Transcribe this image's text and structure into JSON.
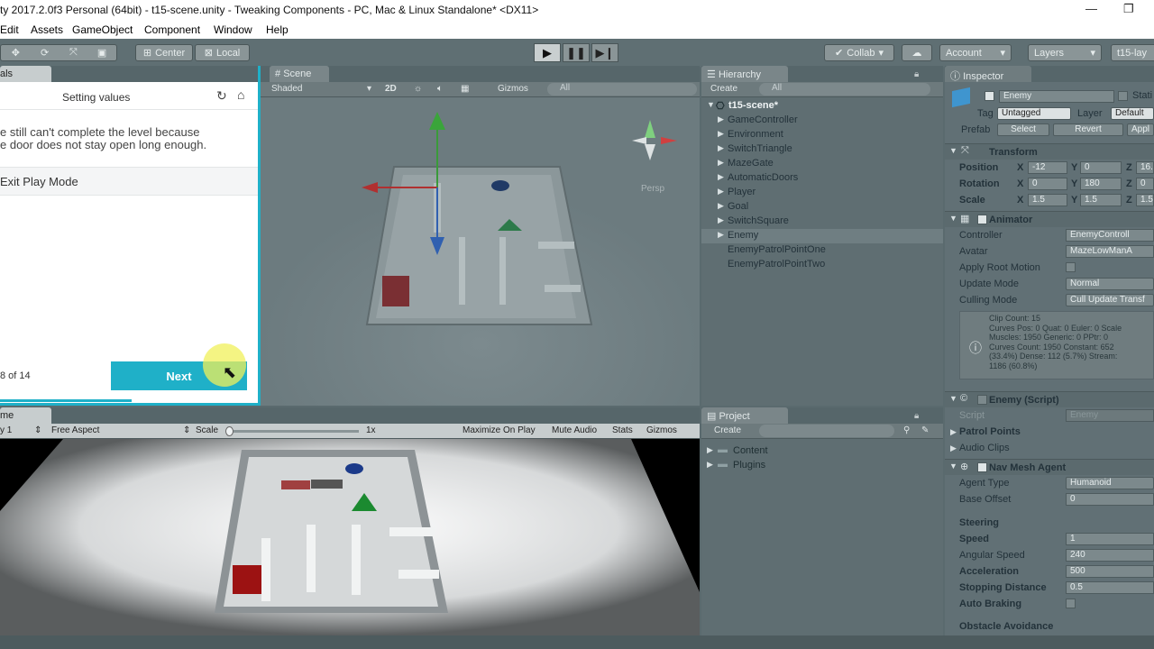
{
  "window": {
    "title": "ty 2017.2.0f3 Personal (64bit) - t15-scene.unity - Tweaking Components - PC, Mac & Linux Standalone* <DX11>"
  },
  "menu": [
    "Edit",
    "Assets",
    "GameObject",
    "Component",
    "Window",
    "Help"
  ],
  "toolbar": {
    "center": "Center",
    "local": "Local",
    "collab": "Collab",
    "account": "Account",
    "layers": "Layers",
    "layout": "t15-lay"
  },
  "tutorial": {
    "tab": "als",
    "title": "Setting values",
    "body_line1": "e still can't complete the level because",
    "body_line2": "e door does not stay open long enough.",
    "step": "Exit Play Mode",
    "progress": "8 of 14",
    "next": "Next"
  },
  "scene": {
    "tab": "Scene",
    "shading": "Shaded",
    "mode2d": "2D",
    "gizmos": "Gizmos",
    "search": "All",
    "persp": "Persp"
  },
  "hierarchy": {
    "tab": "Hierarchy",
    "create": "Create",
    "search": "All",
    "root": "t15-scene*",
    "items": [
      {
        "label": "GameController",
        "prefab": true,
        "arrow": true
      },
      {
        "label": "Environment",
        "prefab": false,
        "arrow": true
      },
      {
        "label": "SwitchTriangle",
        "prefab": true,
        "arrow": true
      },
      {
        "label": "MazeGate",
        "prefab": true,
        "arrow": true
      },
      {
        "label": "AutomaticDoors",
        "prefab": true,
        "arrow": true
      },
      {
        "label": "Player",
        "prefab": true,
        "arrow": true
      },
      {
        "label": "Goal",
        "prefab": true,
        "arrow": true
      },
      {
        "label": "SwitchSquare",
        "prefab": true,
        "arrow": true
      },
      {
        "label": "Enemy",
        "prefab": true,
        "arrow": true,
        "selected": true
      },
      {
        "label": "EnemyPatrolPointOne",
        "prefab": false,
        "arrow": false
      },
      {
        "label": "EnemyPatrolPointTwo",
        "prefab": false,
        "arrow": false
      }
    ]
  },
  "game": {
    "tab": "me",
    "display": "y 1",
    "aspect": "Free Aspect",
    "scale_label": "Scale",
    "scale_value": "1x",
    "maximize": "Maximize On Play",
    "mute": "Mute Audio",
    "stats": "Stats",
    "gizmos": "Gizmos"
  },
  "project": {
    "tab": "Project",
    "create": "Create",
    "folders": [
      "Content",
      "Plugins"
    ]
  },
  "inspector": {
    "tab": "Inspector",
    "name": "Enemy",
    "static": "Stati",
    "tag_label": "Tag",
    "tag": "Untagged",
    "layer_label": "Layer",
    "layer": "Default",
    "prefab_label": "Prefab",
    "select": "Select",
    "revert": "Revert",
    "apply": "Appl",
    "transform": {
      "title": "Transform",
      "position": {
        "label": "Position",
        "x": "-12",
        "y": "0",
        "z": "16."
      },
      "rotation": {
        "label": "Rotation",
        "x": "0",
        "y": "180",
        "z": "0"
      },
      "scale": {
        "label": "Scale",
        "x": "1.5",
        "y": "1.5",
        "z": "1.5"
      }
    },
    "animator": {
      "title": "Animator",
      "controller_label": "Controller",
      "controller": "EnemyControll",
      "avatar_label": "Avatar",
      "avatar": "MazeLowManA",
      "root_motion_label": "Apply Root Motion",
      "update_label": "Update Mode",
      "update": "Normal",
      "culling_label": "Culling Mode",
      "culling": "Cull Update Transf",
      "info": [
        "Clip Count: 15",
        "Curves Pos: 0 Quat: 0 Euler: 0 Scale",
        "Muscles: 1950 Generic: 0 PPtr: 0",
        "Curves Count: 1950 Constant: 652",
        "(33.4%) Dense: 112 (5.7%) Stream:",
        "1186 (60.8%)"
      ]
    },
    "script": {
      "title": "Enemy (Script)",
      "script_label": "Script",
      "script": "Enemy",
      "patrol": "Patrol Points",
      "audio": "Audio Clips"
    },
    "nav": {
      "title": "Nav Mesh Agent",
      "agent_type_label": "Agent Type",
      "agent_type": "Humanoid",
      "base_offset_label": "Base Offset",
      "base_offset": "0",
      "steering": "Steering",
      "speed_label": "Speed",
      "speed": "1",
      "angular_label": "Angular Speed",
      "angular": "240",
      "accel_label": "Acceleration",
      "accel": "500",
      "stopping_label": "Stopping Distance",
      "stopping": "0.5",
      "braking_label": "Auto Braking",
      "obstacle": "Obstacle Avoidance"
    }
  }
}
